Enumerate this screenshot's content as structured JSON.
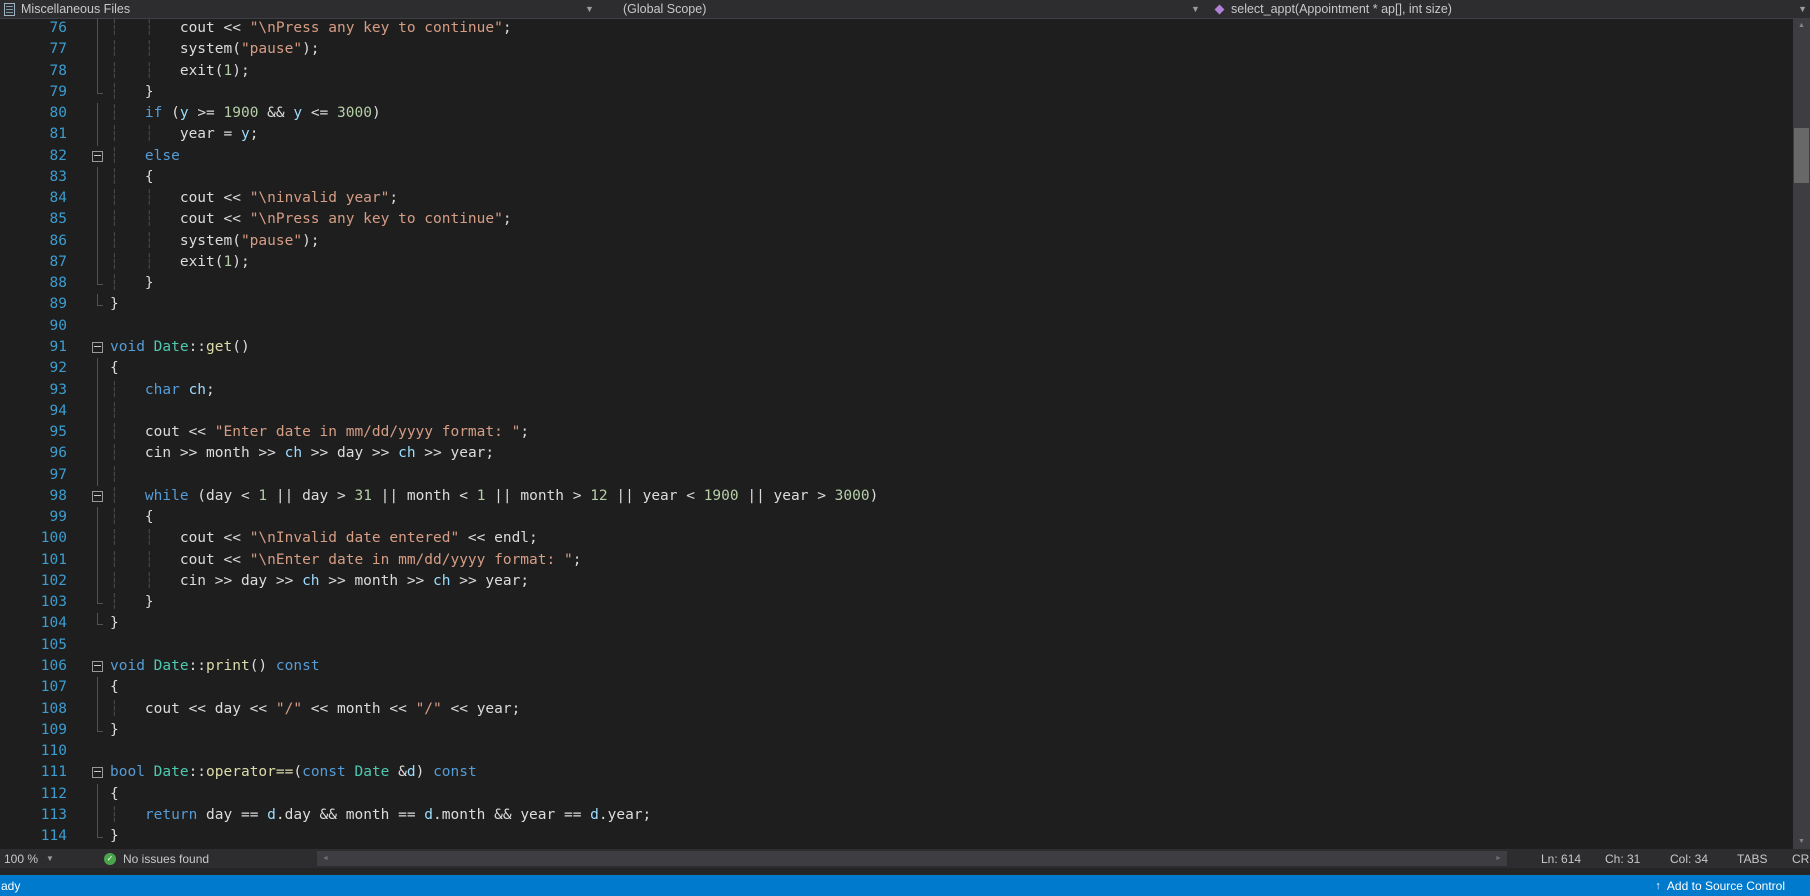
{
  "nav": {
    "project": "Miscellaneous Files",
    "scope": "(Global Scope)",
    "member": "select_appt(Appointment * ap[], int size)"
  },
  "status": {
    "zoom": "100 %",
    "health": "No issues found",
    "ln": "Ln: 614",
    "ch": "Ch: 31",
    "col": "Col: 34",
    "tabs": "TABS",
    "eol": "CRL"
  },
  "footer": {
    "ready": "ady",
    "source_control": "Add to Source Control"
  },
  "colors": {
    "status_bar_blue": "#007ACC",
    "editor_background": "#1E1E1E",
    "keyword": "#569CD6",
    "type_name": "#4EC9B0",
    "function_name": "#DCDCAA",
    "string": "#D69D85",
    "number": "#B5CEA8",
    "local_variable": "#9CDCFE",
    "line_number": "#3C9DD0",
    "method_icon": "#B180D7"
  },
  "editor": {
    "lines": [
      {
        "n": 76,
        "f": "line",
        "t": [
          [
            "g",
            "┆   "
          ],
          [
            "g",
            "┆   "
          ],
          [
            "p",
            "cout << "
          ],
          [
            "s",
            "\"\\nPress any key to continue\""
          ],
          [
            "p",
            ";"
          ]
        ]
      },
      {
        "n": 77,
        "f": "line",
        "t": [
          [
            "g",
            "┆   "
          ],
          [
            "g",
            "┆   "
          ],
          [
            "p",
            "system("
          ],
          [
            "s",
            "\"pause\""
          ],
          [
            "p",
            ");"
          ]
        ]
      },
      {
        "n": 78,
        "f": "line",
        "t": [
          [
            "g",
            "┆   "
          ],
          [
            "g",
            "┆   "
          ],
          [
            "p",
            "exit("
          ],
          [
            "n",
            "1"
          ],
          [
            "p",
            ");"
          ]
        ]
      },
      {
        "n": 79,
        "f": "end",
        "t": [
          [
            "g",
            "┆   "
          ],
          [
            "p",
            "}"
          ]
        ]
      },
      {
        "n": 80,
        "f": "line",
        "t": [
          [
            "g",
            "┆   "
          ],
          [
            "k",
            "if"
          ],
          [
            "p",
            " ("
          ],
          [
            "v",
            "y"
          ],
          [
            "p",
            " >= "
          ],
          [
            "n",
            "1900"
          ],
          [
            "p",
            " && "
          ],
          [
            "v",
            "y"
          ],
          [
            "p",
            " <= "
          ],
          [
            "n",
            "3000"
          ],
          [
            "p",
            ")"
          ]
        ]
      },
      {
        "n": 81,
        "f": "line",
        "t": [
          [
            "g",
            "┆   "
          ],
          [
            "g",
            "┆   "
          ],
          [
            "p",
            "year = "
          ],
          [
            "v",
            "y"
          ],
          [
            "p",
            ";"
          ]
        ]
      },
      {
        "n": 82,
        "f": "box",
        "t": [
          [
            "g",
            "┆   "
          ],
          [
            "k",
            "else"
          ]
        ]
      },
      {
        "n": 83,
        "f": "line",
        "t": [
          [
            "g",
            "┆   "
          ],
          [
            "p",
            "{"
          ]
        ]
      },
      {
        "n": 84,
        "f": "line",
        "t": [
          [
            "g",
            "┆   "
          ],
          [
            "g",
            "┆   "
          ],
          [
            "p",
            "cout << "
          ],
          [
            "s",
            "\"\\ninvalid year\""
          ],
          [
            "p",
            ";"
          ]
        ]
      },
      {
        "n": 85,
        "f": "line",
        "t": [
          [
            "g",
            "┆   "
          ],
          [
            "g",
            "┆   "
          ],
          [
            "p",
            "cout << "
          ],
          [
            "s",
            "\"\\nPress any key to continue\""
          ],
          [
            "p",
            ";"
          ]
        ]
      },
      {
        "n": 86,
        "f": "line",
        "t": [
          [
            "g",
            "┆   "
          ],
          [
            "g",
            "┆   "
          ],
          [
            "p",
            "system("
          ],
          [
            "s",
            "\"pause\""
          ],
          [
            "p",
            ");"
          ]
        ]
      },
      {
        "n": 87,
        "f": "line",
        "t": [
          [
            "g",
            "┆   "
          ],
          [
            "g",
            "┆   "
          ],
          [
            "p",
            "exit("
          ],
          [
            "n",
            "1"
          ],
          [
            "p",
            ");"
          ]
        ]
      },
      {
        "n": 88,
        "f": "end",
        "t": [
          [
            "g",
            "┆   "
          ],
          [
            "p",
            "}"
          ]
        ]
      },
      {
        "n": 89,
        "f": "end",
        "t": [
          [
            "p",
            "}"
          ]
        ]
      },
      {
        "n": 90,
        "f": "",
        "t": []
      },
      {
        "n": 91,
        "f": "box",
        "t": [
          [
            "k",
            "void"
          ],
          [
            "p",
            " "
          ],
          [
            "t",
            "Date"
          ],
          [
            "p",
            "::"
          ],
          [
            "f",
            "get"
          ],
          [
            "p",
            "()"
          ]
        ]
      },
      {
        "n": 92,
        "f": "line",
        "t": [
          [
            "p",
            "{"
          ]
        ]
      },
      {
        "n": 93,
        "f": "line",
        "t": [
          [
            "g",
            "┆   "
          ],
          [
            "k",
            "char"
          ],
          [
            "p",
            " "
          ],
          [
            "v",
            "ch"
          ],
          [
            "p",
            ";"
          ]
        ]
      },
      {
        "n": 94,
        "f": "line",
        "t": [
          [
            "g",
            "┆"
          ]
        ]
      },
      {
        "n": 95,
        "f": "line",
        "t": [
          [
            "g",
            "┆   "
          ],
          [
            "p",
            "cout << "
          ],
          [
            "s",
            "\"Enter date in mm/dd/yyyy format: \""
          ],
          [
            "p",
            ";"
          ]
        ]
      },
      {
        "n": 96,
        "f": "line",
        "t": [
          [
            "g",
            "┆   "
          ],
          [
            "p",
            "cin >> month >> "
          ],
          [
            "v",
            "ch"
          ],
          [
            "p",
            " >> day >> "
          ],
          [
            "v",
            "ch"
          ],
          [
            "p",
            " >> year;"
          ]
        ]
      },
      {
        "n": 97,
        "f": "line",
        "t": [
          [
            "g",
            "┆"
          ]
        ]
      },
      {
        "n": 98,
        "f": "box",
        "t": [
          [
            "g",
            "┆   "
          ],
          [
            "k",
            "while"
          ],
          [
            "p",
            " (day < "
          ],
          [
            "n",
            "1"
          ],
          [
            "p",
            " || day > "
          ],
          [
            "n",
            "31"
          ],
          [
            "p",
            " || month < "
          ],
          [
            "n",
            "1"
          ],
          [
            "p",
            " || month > "
          ],
          [
            "n",
            "12"
          ],
          [
            "p",
            " || year < "
          ],
          [
            "n",
            "1900"
          ],
          [
            "p",
            " || year > "
          ],
          [
            "n",
            "3000"
          ],
          [
            "p",
            ")"
          ]
        ]
      },
      {
        "n": 99,
        "f": "line",
        "t": [
          [
            "g",
            "┆   "
          ],
          [
            "p",
            "{"
          ]
        ]
      },
      {
        "n": 100,
        "f": "line",
        "t": [
          [
            "g",
            "┆   "
          ],
          [
            "g",
            "┆   "
          ],
          [
            "p",
            "cout << "
          ],
          [
            "s",
            "\"\\nInvalid date entered\""
          ],
          [
            "p",
            " << endl;"
          ]
        ]
      },
      {
        "n": 101,
        "f": "line",
        "t": [
          [
            "g",
            "┆   "
          ],
          [
            "g",
            "┆   "
          ],
          [
            "p",
            "cout << "
          ],
          [
            "s",
            "\"\\nEnter date in mm/dd/yyyy format: \""
          ],
          [
            "p",
            ";"
          ]
        ]
      },
      {
        "n": 102,
        "f": "line",
        "t": [
          [
            "g",
            "┆   "
          ],
          [
            "g",
            "┆   "
          ],
          [
            "p",
            "cin >> day >> "
          ],
          [
            "v",
            "ch"
          ],
          [
            "p",
            " >> month >> "
          ],
          [
            "v",
            "ch"
          ],
          [
            "p",
            " >> year;"
          ]
        ]
      },
      {
        "n": 103,
        "f": "end",
        "t": [
          [
            "g",
            "┆   "
          ],
          [
            "p",
            "}"
          ]
        ]
      },
      {
        "n": 104,
        "f": "end",
        "t": [
          [
            "p",
            "}"
          ]
        ]
      },
      {
        "n": 105,
        "f": "",
        "t": []
      },
      {
        "n": 106,
        "f": "box",
        "t": [
          [
            "k",
            "void"
          ],
          [
            "p",
            " "
          ],
          [
            "t",
            "Date"
          ],
          [
            "p",
            "::"
          ],
          [
            "f",
            "print"
          ],
          [
            "p",
            "() "
          ],
          [
            "k",
            "const"
          ]
        ]
      },
      {
        "n": 107,
        "f": "line",
        "t": [
          [
            "p",
            "{"
          ]
        ]
      },
      {
        "n": 108,
        "f": "line",
        "t": [
          [
            "g",
            "┆   "
          ],
          [
            "p",
            "cout << day << "
          ],
          [
            "s",
            "\"/\""
          ],
          [
            "p",
            " << month << "
          ],
          [
            "s",
            "\"/\""
          ],
          [
            "p",
            " << year;"
          ]
        ]
      },
      {
        "n": 109,
        "f": "end",
        "t": [
          [
            "p",
            "}"
          ]
        ]
      },
      {
        "n": 110,
        "f": "",
        "t": []
      },
      {
        "n": 111,
        "f": "box",
        "t": [
          [
            "k",
            "bool"
          ],
          [
            "p",
            " "
          ],
          [
            "t",
            "Date"
          ],
          [
            "p",
            "::"
          ],
          [
            "f",
            "operator=="
          ],
          [
            "p",
            "("
          ],
          [
            "k",
            "const"
          ],
          [
            "p",
            " "
          ],
          [
            "t",
            "Date"
          ],
          [
            "p",
            " &"
          ],
          [
            "v",
            "d"
          ],
          [
            "p",
            ") "
          ],
          [
            "k",
            "const"
          ]
        ]
      },
      {
        "n": 112,
        "f": "line",
        "t": [
          [
            "p",
            "{"
          ]
        ]
      },
      {
        "n": 113,
        "f": "line",
        "t": [
          [
            "g",
            "┆   "
          ],
          [
            "k",
            "return"
          ],
          [
            "p",
            " day == "
          ],
          [
            "v",
            "d"
          ],
          [
            "p",
            ".day && month == "
          ],
          [
            "v",
            "d"
          ],
          [
            "p",
            ".month && year == "
          ],
          [
            "v",
            "d"
          ],
          [
            "p",
            ".year;"
          ]
        ]
      },
      {
        "n": 114,
        "f": "end",
        "t": [
          [
            "p",
            "}"
          ]
        ]
      }
    ]
  }
}
